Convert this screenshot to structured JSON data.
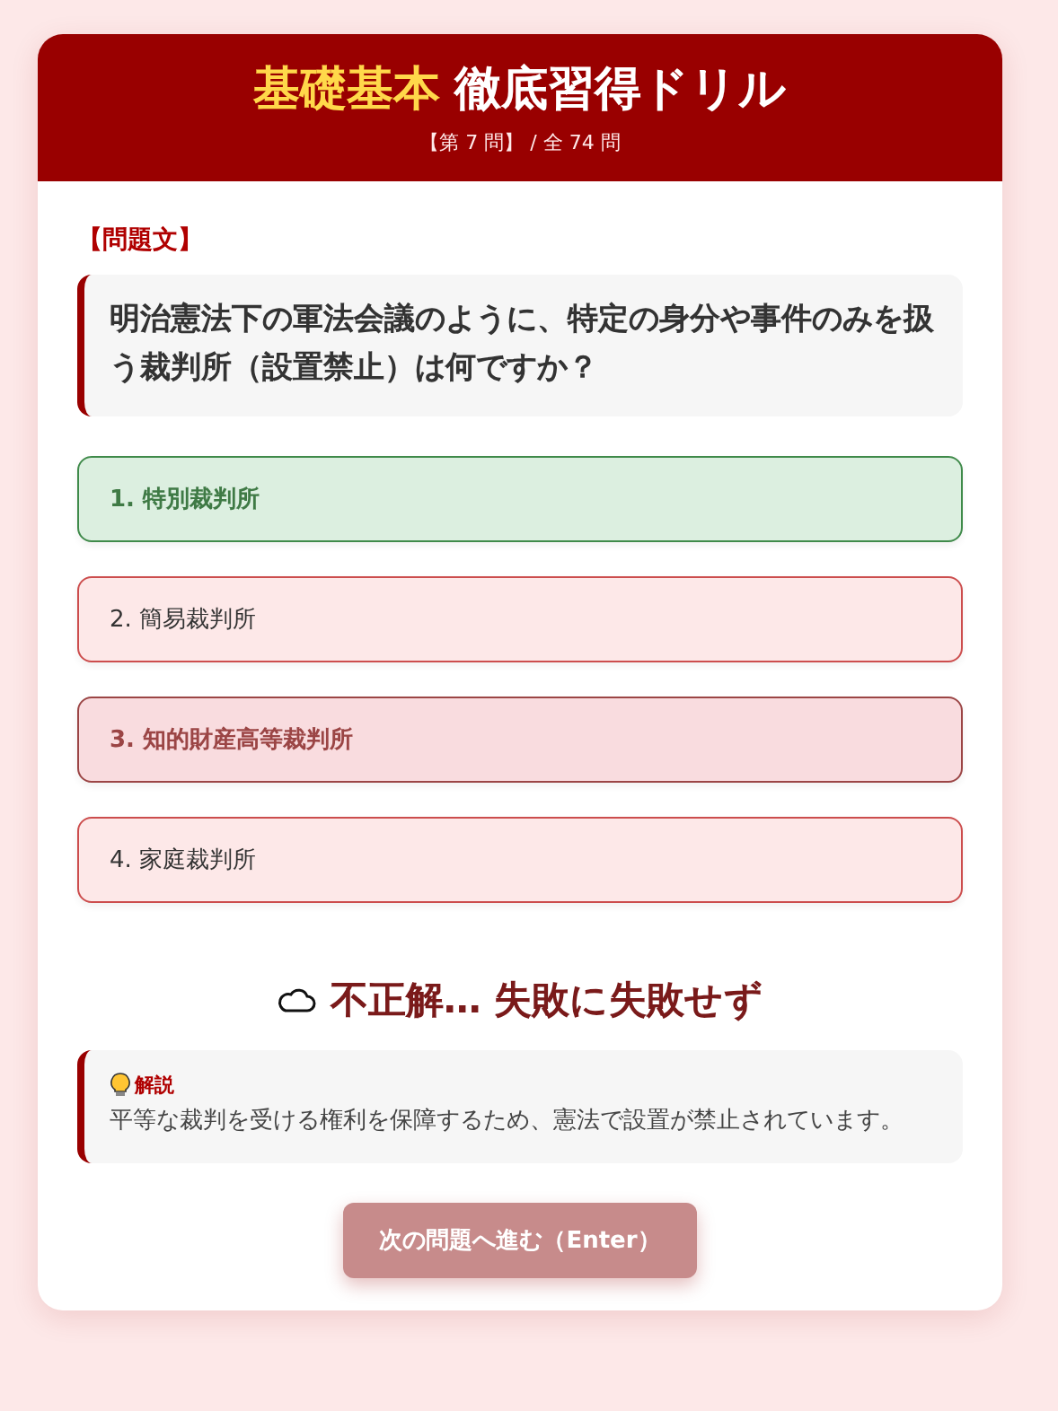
{
  "header": {
    "title_accent": "基礎基本",
    "title": "徹底習得ドリル",
    "progress": "【第 7 問】 / 全 74 問"
  },
  "question": {
    "label": "【問題文】",
    "text": "明治憲法下の軍法会議のように、特定の身分や事件のみを扱う裁判所（設置禁止）は何ですか？"
  },
  "options": [
    {
      "label": "1. 特別裁判所",
      "kind": "correct"
    },
    {
      "label": "2. 簡易裁判所",
      "kind": "incorrect"
    },
    {
      "label": "3. 知的財産高等裁判所",
      "kind": "chosen"
    },
    {
      "label": "4. 家庭裁判所",
      "kind": "incorrect"
    }
  ],
  "result": {
    "text": "不正解… 失敗に失敗せず"
  },
  "explanation": {
    "label": "解説",
    "text": "平等な裁判を受ける権利を保障するため、憲法で設置が禁止されています。"
  },
  "next_button": {
    "label": "次の問題へ進む（Enter）",
    "disabled": true
  }
}
